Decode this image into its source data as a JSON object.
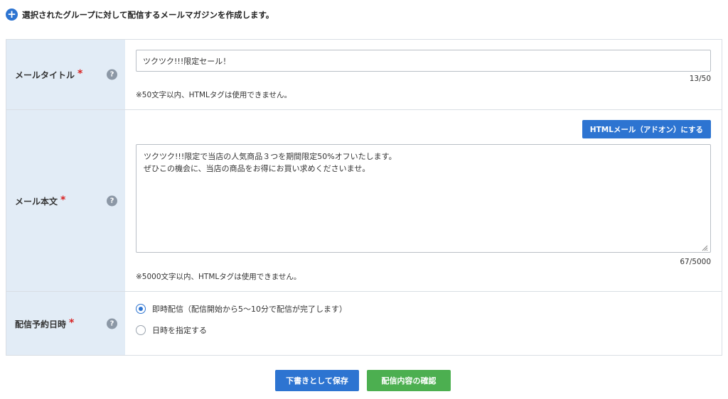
{
  "header": {
    "text": "選択されたグループに対して配信するメールマガジンを作成します。"
  },
  "fields": {
    "title": {
      "label": "メールタイトル",
      "required_mark": "*",
      "value": "ツクツク!!!限定セール！",
      "counter": "13/50",
      "note": "※50文字以内、HTMLタグは使用できません。"
    },
    "body": {
      "label": "メール本文",
      "required_mark": "*",
      "addon_button": "HTMLメール（アドオン）にする",
      "value": "ツクツク!!!限定で当店の人気商品３つを期間限定50%オフいたします。\nぜひこの機会に、当店の商品をお得にお買い求めくださいませ。",
      "counter": "67/5000",
      "note": "※5000文字以内、HTMLタグは使用できません。"
    },
    "schedule": {
      "label": "配信予約日時",
      "required_mark": "*",
      "options": [
        {
          "label": "即時配信（配信開始から5〜10分で配信が完了します）",
          "checked": true
        },
        {
          "label": "日時を指定する",
          "checked": false
        }
      ]
    }
  },
  "help_icon_glyph": "?",
  "buttons": {
    "draft": "下書きとして保存",
    "confirm": "配信内容の確認"
  },
  "colors": {
    "primary": "#2d74d1",
    "success": "#4caf50",
    "required": "#d82121",
    "label_bg": "#e2ecf6"
  }
}
